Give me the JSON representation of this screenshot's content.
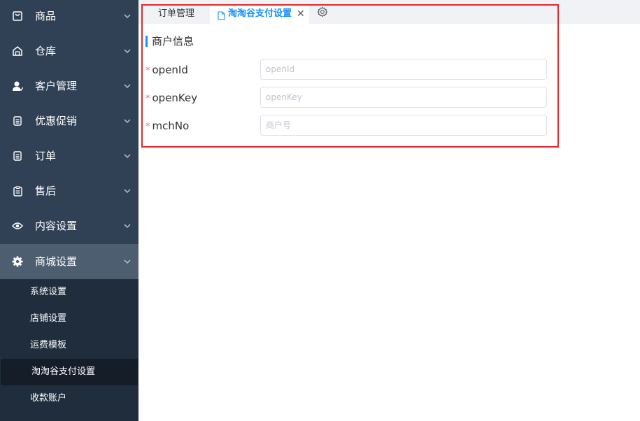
{
  "sidebar": {
    "menu": [
      {
        "label": "商品",
        "icon": "product-box-icon"
      },
      {
        "label": "仓库",
        "icon": "warehouse-icon"
      },
      {
        "label": "客户管理",
        "icon": "customer-icon"
      },
      {
        "label": "优惠促销",
        "icon": "promotion-doc-icon"
      },
      {
        "label": "订单",
        "icon": "order-doc-icon"
      },
      {
        "label": "售后",
        "icon": "aftersale-clipboard-icon"
      },
      {
        "label": "内容设置",
        "icon": "eye-icon"
      },
      {
        "label": "商城设置",
        "icon": "gear-icon"
      }
    ],
    "submenu": [
      {
        "label": "系统设置"
      },
      {
        "label": "店铺设置"
      },
      {
        "label": "运费模板"
      },
      {
        "label": "淘淘谷支付设置"
      },
      {
        "label": "收款账户"
      }
    ],
    "active_menu": "商城设置",
    "active_submenu": "淘淘谷支付设置"
  },
  "tabs": [
    {
      "label": "订单管理"
    },
    {
      "label": "淘淘谷支付设置",
      "close": "✕"
    }
  ],
  "content": {
    "section_title": "商户信息",
    "required_mark": "*",
    "fields": [
      {
        "label": "openId",
        "value": "",
        "placeholder": "openId"
      },
      {
        "label": "openKey",
        "value": "",
        "placeholder": "openKey"
      },
      {
        "label": "mchNo",
        "value": "",
        "placeholder": "商户号"
      }
    ]
  },
  "colors": {
    "sidebar_bg": "#304156",
    "submenu_bg": "#1f2d3d",
    "accent": "#1890ff",
    "required": "#f56c6c",
    "highlight": "#e4282c"
  }
}
